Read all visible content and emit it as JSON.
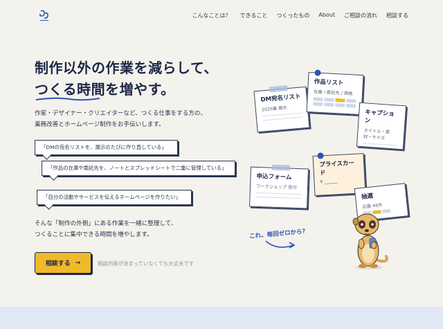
{
  "logo": {
    "name": "site-logo",
    "text": "a a a a"
  },
  "nav": [
    {
      "label": "こんなことは？"
    },
    {
      "label": "できること"
    },
    {
      "label": "つくったもの"
    },
    {
      "label": "About"
    },
    {
      "label": "ご相談の流れ"
    },
    {
      "label": "相談する"
    }
  ],
  "hero": {
    "title_line1": "制作以外の作業を減らして、",
    "title_line2": "つくる時間を増やす。",
    "desc_line1": "作家・デザイナー・クリエイターなど、つくる仕事をする方の、",
    "desc_line2": "業務改善とホームページ制作をお手伝いします。"
  },
  "bubbles": [
    {
      "text": "「DMの宛名リストを、展示のたびに作り直している」"
    },
    {
      "text": "「作品の在庫や委託先を、ノートとスプレッドシートで二重に管理している」"
    },
    {
      "text": "「自分の活動やサービスを伝えるホームページを作りたい」"
    }
  ],
  "sub": {
    "line1": "そんな「制作の外側」にある作業を一緒に整理して、",
    "line2": "つくることに集中できる時間を増やします。"
  },
  "cta": {
    "label": "相談する",
    "arrow": "→",
    "note": "相談内容が決まっていなくても大丈夫です"
  },
  "illustration": {
    "cards": [
      {
        "title": "DM宛名リスト",
        "sub": "2026春 展示"
      },
      {
        "title": "作品リスト",
        "sub": "在庫 / 委託先 / 価格"
      },
      {
        "title": "キャプション",
        "sub": "タイトル・素材・サイズ"
      },
      {
        "title": "申込フォーム",
        "sub": "ワークショップ 受付"
      },
      {
        "title": "プライスカード",
        "sub": "¥ ______"
      },
      {
        "title": "抽選",
        "sub": "応募 48件"
      }
    ],
    "tagline": "これ、毎回ゼロから？",
    "colors": {
      "accent": "#f0b92a",
      "navy": "#1b2747",
      "blue": "#2a54b8"
    }
  }
}
